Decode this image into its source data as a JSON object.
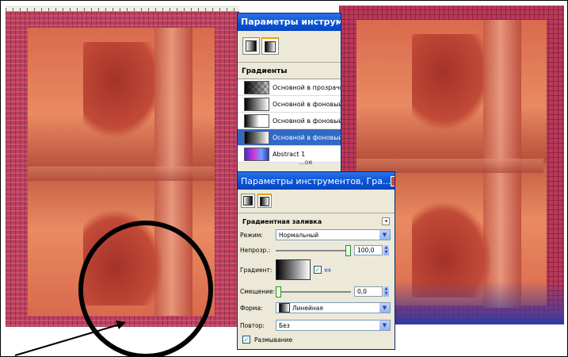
{
  "tool_options_back": {
    "title": "Параметры инструмент",
    "section_label": "Градиенты",
    "gradients": [
      {
        "name": "Основной в прозрачн",
        "preview": "checker"
      },
      {
        "name": "Основной в фоновый",
        "preview": "fg-bg"
      },
      {
        "name": "Основной в фоновый",
        "preview": "fg-bg-h"
      },
      {
        "name": "Основной в фоновый",
        "preview": "fg-bg-i",
        "selected": true
      },
      {
        "name": "Abstract 1",
        "preview": "abstract"
      }
    ],
    "cut_text": "...ое"
  },
  "tool_options_front": {
    "title": "Параметры инструментов, Гра...",
    "section_label": "Градиентная заливка",
    "mode_label": "Режим:",
    "mode_value": "Нормальный",
    "opacity_label": "Непрозр.:",
    "opacity_value": "100,0",
    "opacity_fraction": 1.0,
    "gradient_label": "Градиент:",
    "offset_label": "Смещение:",
    "offset_value": "0,0",
    "offset_fraction": 0.0,
    "shape_label": "Форма:",
    "shape_value": "Линейная",
    "repeat_label": "Повтор:",
    "repeat_value": "Без",
    "dither_label": "Размывание",
    "dither_checked": true
  },
  "colors": {
    "frame_red": "#c13d5e",
    "titlebar_blue": "#0a55d8",
    "selection_blue": "#316ac5",
    "bottom_band_blue": "#2a3ba6"
  }
}
